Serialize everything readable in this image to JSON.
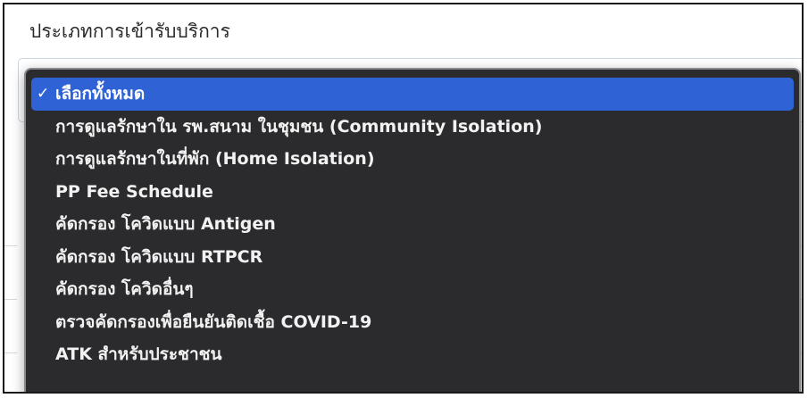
{
  "field": {
    "label": "ประเภทการเข้ารับบริการ"
  },
  "dropdown": {
    "check_glyph": "✓",
    "selected_index": 0,
    "options": [
      "เลือกทั้งหมด",
      "การดูแลรักษาใน รพ.สนาม ในชุมชน (Community Isolation)",
      "การดูแลรักษาในที่พัก (Home Isolation)",
      "PP Fee Schedule",
      "คัดกรอง โควิดแบบ Antigen",
      "คัดกรอง โควิดแบบ RTPCR",
      "คัดกรอง โควิดอื่นๆ",
      "ตรวจคัดกรองเพื่อยืนยันติดเชื้อ COVID-19",
      "ATK สำหรับประชาชน"
    ]
  },
  "colors": {
    "menu_background": "#2b2b2d",
    "selected_highlight": "#2f63d5",
    "menu_text": "#f2f2f2"
  }
}
